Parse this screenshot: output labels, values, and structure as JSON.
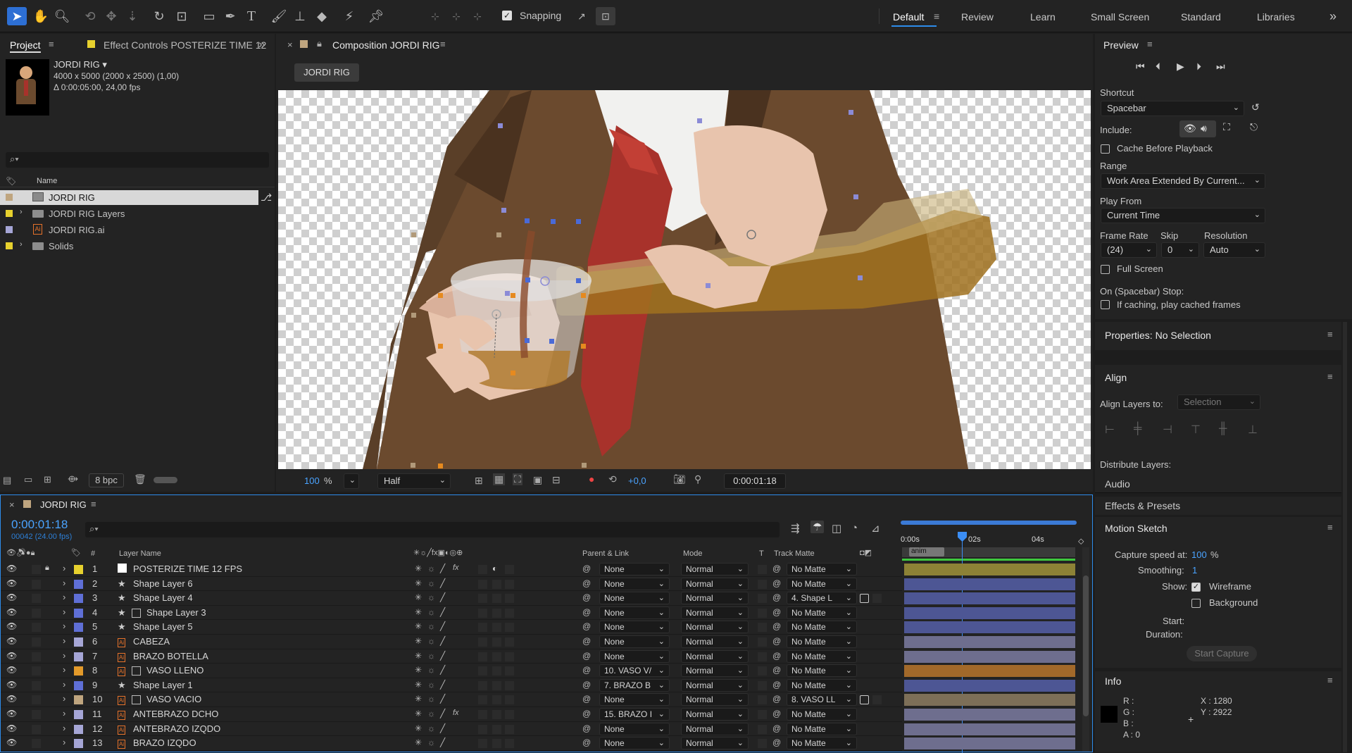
{
  "toolbar": {
    "snapping_label": "Snapping",
    "workspaces": [
      "Default",
      "Review",
      "Learn",
      "Small Screen",
      "Standard",
      "Libraries"
    ],
    "more": "»"
  },
  "project": {
    "tab_label": "Project",
    "effect_controls_tab": "Effect Controls POSTERIZE TIME 12",
    "comp_name": "JORDI RIG ▾",
    "comp_size": "4000 x 5000  (2000 x 2500) (1,00)",
    "comp_duration": "Δ 0:00:05:00, 24,00 fps",
    "search_placeholder": "",
    "column_name": "Name",
    "items": [
      {
        "name": "JORDI RIG",
        "color": "#bfa57f",
        "icon": "composition-icon",
        "selected": true
      },
      {
        "name": "JORDI RIG Layers",
        "color": "#e7d12e",
        "icon": "folder-icon",
        "expandable": true
      },
      {
        "name": "JORDI RIG.ai",
        "color": "#a6a6d6",
        "icon": "illustrator-file-icon"
      },
      {
        "name": "Solids",
        "color": "#e7d12e",
        "icon": "folder-icon",
        "expandable": true
      }
    ],
    "bpc": "8 bpc"
  },
  "composition": {
    "tab_label": "Composition JORDI RIG",
    "flowchart_label": "JORDI RIG",
    "zoom": "100",
    "zoom_unit": "%",
    "resolution": "Half",
    "exposure": "+0,0",
    "timecode": "0:00:01:18"
  },
  "preview": {
    "title": "Preview",
    "shortcut_label": "Shortcut",
    "shortcut_value": "Spacebar",
    "include_label": "Include:",
    "cache_label": "Cache Before Playback",
    "range_label": "Range",
    "range_value": "Work Area Extended By Current...",
    "play_from_label": "Play From",
    "play_from_value": "Current Time",
    "frame_rate_label": "Frame Rate",
    "frame_rate_value": "(24)",
    "skip_label": "Skip",
    "skip_value": "0",
    "resolution_label": "Resolution",
    "resolution_value": "Auto",
    "full_screen_label": "Full Screen",
    "stop_label": "On (Spacebar) Stop:",
    "if_caching_label": "If caching, play cached frames"
  },
  "properties": {
    "title": "Properties: No Selection"
  },
  "align": {
    "title": "Align",
    "align_to_label": "Align Layers to:",
    "align_to_value": "Selection",
    "distribute_label": "Distribute Layers:"
  },
  "audio": {
    "title": "Audio"
  },
  "effects": {
    "title": "Effects & Presets"
  },
  "motion_sketch": {
    "title": "Motion Sketch",
    "capture_label": "Capture speed at:",
    "capture_value": "100",
    "capture_unit": "%",
    "smoothing_label": "Smoothing:",
    "smoothing_value": "1",
    "show_label": "Show:",
    "wireframe_label": "Wireframe",
    "background_label": "Background",
    "start_label": "Start:",
    "duration_label": "Duration:",
    "start_capture_label": "Start Capture"
  },
  "info": {
    "title": "Info",
    "r": "R :",
    "g": "G :",
    "b": "B :",
    "a": "A :  0",
    "x": "X :  1280",
    "y": "Y :  2922"
  },
  "timeline": {
    "tab_label": "JORDI RIG",
    "current_time": "0:00:01:18",
    "frame_info": "00042 (24.00 fps)",
    "columns": {
      "layer_name": "Layer Name",
      "parent": "Parent & Link",
      "mode": "Mode",
      "t": "T",
      "track_matte": "Track Matte"
    },
    "ruler_labels": [
      "0:00s",
      "02s",
      "04s"
    ],
    "work_area_label": "anim",
    "layers": [
      {
        "num": "1",
        "name": "POSTERIZE TIME 12 FPS",
        "color": "#e7d12e",
        "type": "solid",
        "parent": "None",
        "mode": "Normal",
        "matte": "No Matte",
        "bar": "#8d8236",
        "fx": true,
        "locked": true
      },
      {
        "num": "2",
        "name": "Shape Layer 6",
        "color": "#5f6fd6",
        "type": "shape",
        "parent": "None",
        "mode": "Normal",
        "matte": "No Matte",
        "bar": "#4d5694"
      },
      {
        "num": "3",
        "name": "Shape Layer 4",
        "color": "#5f6fd6",
        "type": "shape",
        "parent": "None",
        "mode": "Normal",
        "matte": "4. Shape L",
        "bar": "#4d5694"
      },
      {
        "num": "4",
        "name": "Shape Layer 3",
        "color": "#5f6fd6",
        "type": "shape-matte",
        "parent": "None",
        "mode": "Normal",
        "matte": "No Matte",
        "bar": "#4d5694"
      },
      {
        "num": "5",
        "name": "Shape Layer 5",
        "color": "#5f6fd6",
        "type": "shape",
        "parent": "None",
        "mode": "Normal",
        "matte": "No Matte",
        "bar": "#4d5694"
      },
      {
        "num": "6",
        "name": "CABEZA",
        "color": "#a6a6d6",
        "type": "ai",
        "parent": "None",
        "mode": "Normal",
        "matte": "No Matte",
        "bar": "#6e6e8e"
      },
      {
        "num": "7",
        "name": "BRAZO BOTELLA",
        "color": "#a6a6d6",
        "type": "ai",
        "parent": "None",
        "mode": "Normal",
        "matte": "No Matte",
        "bar": "#6e6e8e"
      },
      {
        "num": "8",
        "name": "VASO LLENO",
        "color": "#e39a2a",
        "type": "ai-matte",
        "parent": "10. VASO V/",
        "mode": "Normal",
        "matte": "No Matte",
        "bar": "#a2692a"
      },
      {
        "num": "9",
        "name": "Shape Layer 1",
        "color": "#5f6fd6",
        "type": "shape",
        "parent": "7. BRAZO B",
        "mode": "Normal",
        "matte": "No Matte",
        "bar": "#4d5694"
      },
      {
        "num": "10",
        "name": "VASO VACIO",
        "color": "#bfa57f",
        "type": "ai-matte",
        "parent": "None",
        "mode": "Normal",
        "matte": "8. VASO LL",
        "bar": "#7d6f58"
      },
      {
        "num": "11",
        "name": "ANTEBRAZO DCHO",
        "color": "#a6a6d6",
        "type": "ai",
        "parent": "15. BRAZO I",
        "mode": "Normal",
        "matte": "No Matte",
        "bar": "#6e6e8e",
        "fx": true
      },
      {
        "num": "12",
        "name": "ANTEBRAZO IZQDO",
        "color": "#a6a6d6",
        "type": "ai",
        "parent": "None",
        "mode": "Normal",
        "matte": "No Matte",
        "bar": "#6e6e8e"
      },
      {
        "num": "13",
        "name": "BRAZO IZQDO",
        "color": "#a6a6d6",
        "type": "ai",
        "parent": "None",
        "mode": "Normal",
        "matte": "No Matte",
        "bar": "#6e6e8e"
      }
    ]
  },
  "colors": {
    "accent": "#2d8ceb",
    "timecode": "#4aa3ff",
    "panel": "#232323",
    "bg": "#1d1d1d"
  }
}
